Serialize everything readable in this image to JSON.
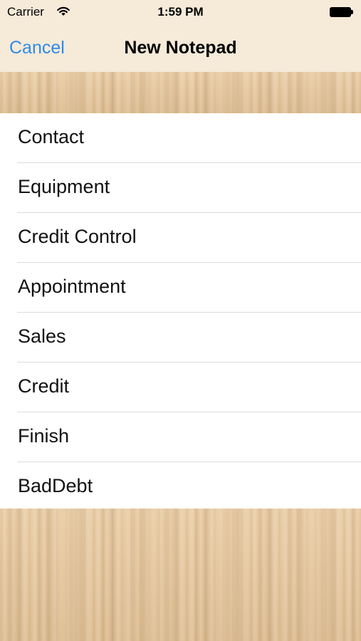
{
  "status_bar": {
    "carrier": "Carrier",
    "wifi_icon": "wifi-icon",
    "time": "1:59 PM",
    "battery_icon": "battery-icon"
  },
  "nav_bar": {
    "cancel_label": "Cancel",
    "title": "New Notepad",
    "accent_color": "#2e8be6"
  },
  "notepad_types": [
    {
      "label": "Contact"
    },
    {
      "label": "Equipment"
    },
    {
      "label": "Credit Control"
    },
    {
      "label": "Appointment"
    },
    {
      "label": "Sales"
    },
    {
      "label": "Credit"
    },
    {
      "label": "Finish"
    },
    {
      "label": "BadDebt"
    }
  ]
}
